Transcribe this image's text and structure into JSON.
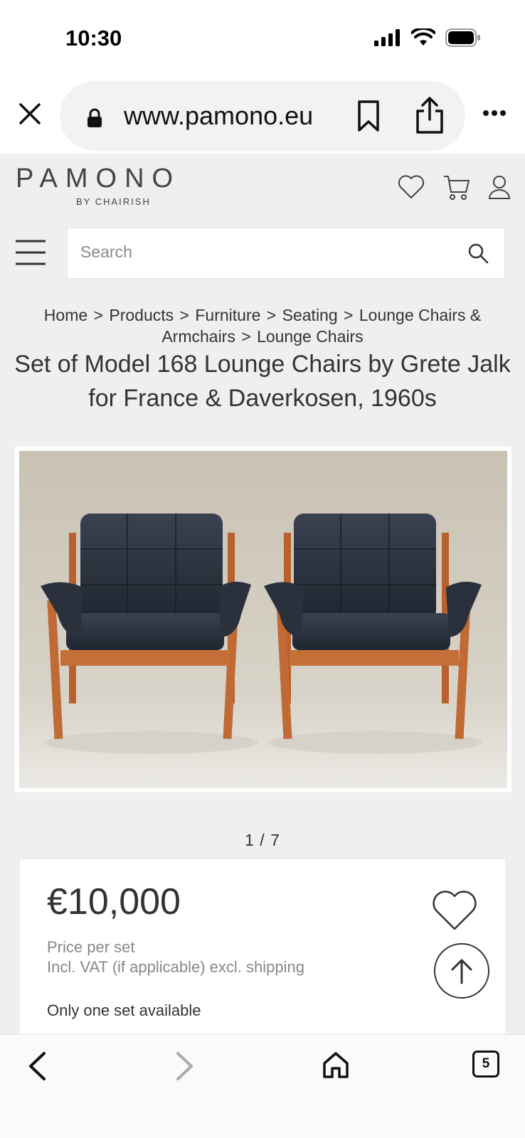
{
  "status_bar": {
    "time": "10:30"
  },
  "browser": {
    "url": "www.pamono.eu",
    "icons": [
      "close-icon",
      "lock-icon",
      "bookmark-icon",
      "share-icon",
      "more-icon"
    ]
  },
  "site": {
    "logo": "PAMONO",
    "logo_sub": "BY CHAIRISH",
    "header_icons": [
      "heart-icon",
      "cart-icon",
      "user-icon"
    ],
    "search_placeholder": "Search"
  },
  "breadcrumb": [
    "Home",
    "Products",
    "Furniture",
    "Seating",
    "Lounge Chairs & Armchairs",
    "Lounge Chairs"
  ],
  "breadcrumb_separator": ">",
  "product": {
    "title": "Set of Model 168 Lounge Chairs by Grete Jalk for France & Daverkosen, 1960s",
    "image_counter": "1 / 7",
    "price": "€10,000",
    "price_unit": "Price per set",
    "price_tax_note": "Incl. VAT (if applicable) excl. shipping",
    "availability": "Only one set available"
  },
  "toolbar": {
    "tab_count": "5"
  },
  "colors": {
    "page_bg": "#efefef",
    "text": "#333333",
    "muted": "#888888",
    "leather": "#2b3340",
    "teak": "#c06a35"
  }
}
